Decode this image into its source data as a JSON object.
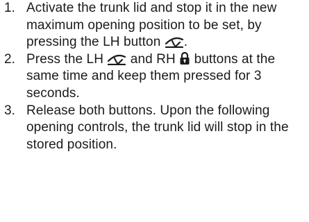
{
  "steps": [
    {
      "number": "1.",
      "text_before_icon": "Activate the trunk lid and stop it in the new maximum opening position to be set, by pressing the LH button ",
      "icon": "trunk-lid-icon",
      "text_after_icon": "."
    },
    {
      "number": "2.",
      "text_part1": "Press the LH ",
      "icon1": "trunk-lid-icon",
      "text_part2": " and RH ",
      "icon2": "lock-icon",
      "text_part3": " buttons at the same time and keep them pressed for 3 seconds."
    },
    {
      "number": "3.",
      "text": "Release both buttons. Upon the following opening controls, the trunk lid will stop in the stored position."
    }
  ]
}
